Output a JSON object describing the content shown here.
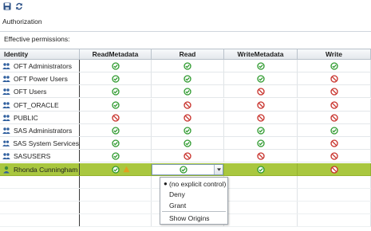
{
  "toolbar": {
    "buttons": [
      {
        "icon": "save-icon"
      },
      {
        "icon": "refresh-icon"
      }
    ]
  },
  "section_title": "Authorization",
  "effective_label": "Effective permissions:",
  "columns": [
    "Identity",
    "ReadMetadata",
    "Read",
    "WriteMetadata",
    "Write"
  ],
  "rows": [
    {
      "identity": "OFT Administrators",
      "type": "group",
      "perms": [
        "grant",
        "grant",
        "grant",
        "grant"
      ]
    },
    {
      "identity": "OFT Power Users",
      "type": "group",
      "perms": [
        "grant",
        "grant",
        "grant",
        "deny"
      ]
    },
    {
      "identity": "OFT Users",
      "type": "group",
      "perms": [
        "grant",
        "grant",
        "deny",
        "deny"
      ]
    },
    {
      "identity": "OFT_ORACLE",
      "type": "group",
      "perms": [
        "grant",
        "deny",
        "deny",
        "deny"
      ]
    },
    {
      "identity": "PUBLIC",
      "type": "group",
      "perms": [
        "deny",
        "deny",
        "deny",
        "deny"
      ]
    },
    {
      "identity": "SAS Administrators",
      "type": "group",
      "perms": [
        "grant",
        "grant",
        "grant",
        "grant"
      ]
    },
    {
      "identity": "SAS System Services",
      "type": "group",
      "perms": [
        "grant",
        "grant",
        "grant",
        "deny"
      ]
    },
    {
      "identity": "SASUSERS",
      "type": "group",
      "perms": [
        "grant",
        "deny",
        "deny",
        "deny"
      ]
    },
    {
      "identity": "Rhonda Cunningham",
      "type": "user",
      "selected": true,
      "perms": [
        "grant",
        "grant",
        "grant",
        "deny"
      ]
    }
  ],
  "combo": {
    "selected": "grant"
  },
  "dropdown": {
    "items": [
      {
        "label": "(no explicit control)",
        "checked": true
      },
      {
        "label": "Deny",
        "checked": false
      },
      {
        "label": "Grant",
        "checked": false
      },
      {
        "label": "Show Origins",
        "checked": false
      }
    ]
  },
  "colors": {
    "grant": "#2e9a2e",
    "deny": "#c8302a",
    "selected_row": "#a9c73f",
    "group_icon": "#2f5f9e",
    "user_icon": "#3f8a3f"
  }
}
